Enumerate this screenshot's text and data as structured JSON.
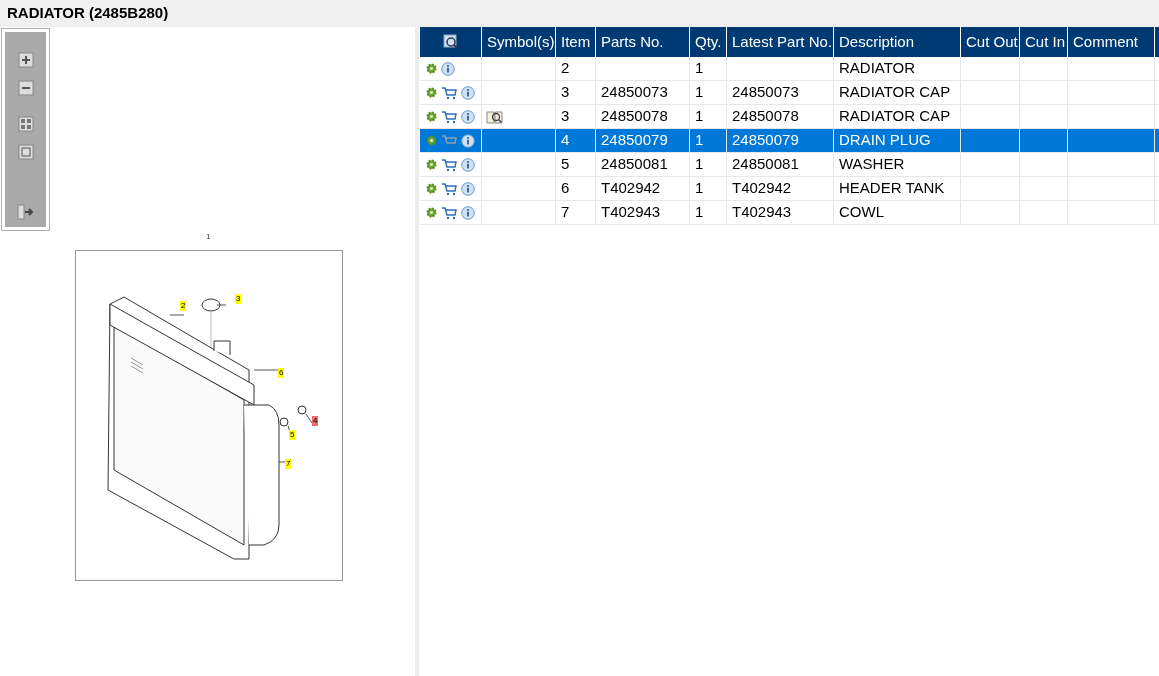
{
  "title": "RADIATOR (2485B280)",
  "toolbar": [
    {
      "kind": "zoom-in"
    },
    {
      "kind": "zoom-out"
    },
    {
      "kind": "fit"
    },
    {
      "kind": "actual"
    },
    {
      "kind": "export"
    }
  ],
  "diagram": {
    "caption": "1",
    "callouts": [
      {
        "label": "2",
        "selected": false
      },
      {
        "label": "3",
        "selected": false
      },
      {
        "label": "6",
        "selected": false
      },
      {
        "label": "4",
        "selected": true
      },
      {
        "label": "5",
        "selected": false
      },
      {
        "label": "7",
        "selected": false
      }
    ]
  },
  "table": {
    "columns": [
      "Symbol(s)",
      "Item",
      "Parts No.",
      "Qty.",
      "Latest Part No.",
      "Description",
      "Cut Out",
      "Cut In",
      "Comment"
    ],
    "rows": [
      {
        "cart": false,
        "symbol": false,
        "selected": false,
        "cells": [
          "",
          "2",
          "",
          "1",
          "",
          "RADIATOR"
        ]
      },
      {
        "cart": true,
        "symbol": false,
        "selected": false,
        "cells": [
          "",
          "3",
          "24850073",
          "1",
          "24850073",
          "RADIATOR CAP"
        ]
      },
      {
        "cart": true,
        "symbol": true,
        "selected": false,
        "cells": [
          "",
          "3",
          "24850078",
          "1",
          "24850078",
          "RADIATOR CAP"
        ]
      },
      {
        "cart": true,
        "symbol": false,
        "selected": true,
        "cells": [
          "",
          "4",
          "24850079",
          "1",
          "24850079",
          "DRAIN PLUG"
        ]
      },
      {
        "cart": true,
        "symbol": false,
        "selected": false,
        "cells": [
          "",
          "5",
          "24850081",
          "1",
          "24850081",
          "WASHER"
        ]
      },
      {
        "cart": true,
        "symbol": false,
        "selected": false,
        "cells": [
          "",
          "6",
          "T402942",
          "1",
          "T402942",
          "HEADER TANK"
        ]
      },
      {
        "cart": true,
        "symbol": false,
        "selected": false,
        "cells": [
          "",
          "7",
          "T402943",
          "1",
          "T402943",
          "COWL"
        ]
      }
    ]
  }
}
